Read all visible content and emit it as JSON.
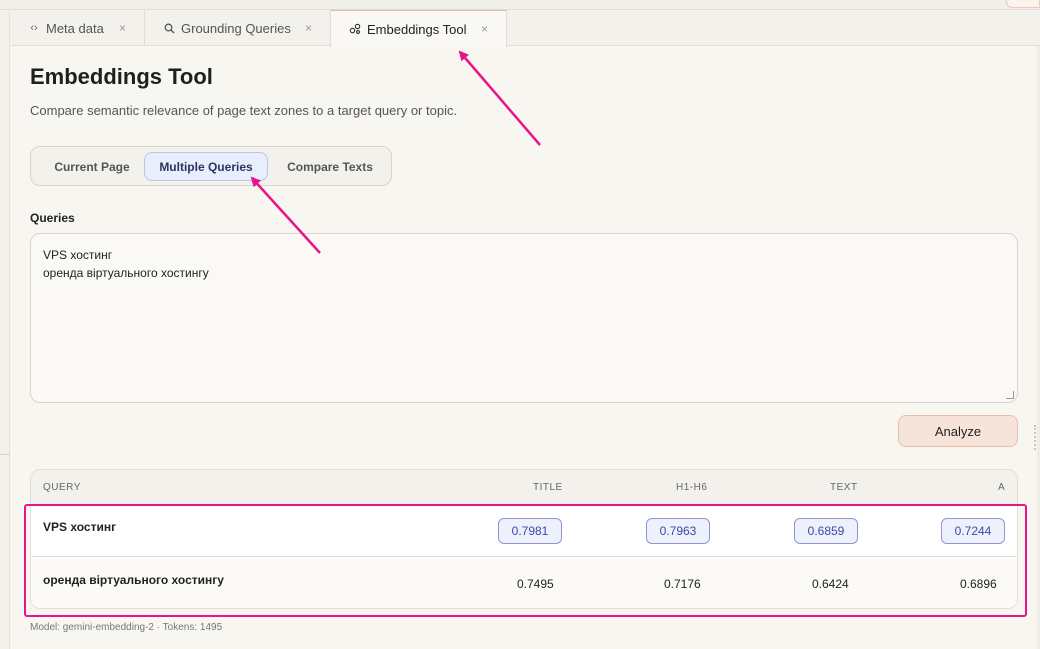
{
  "tabs": [
    {
      "icon": "code-icon",
      "label": "Meta data",
      "active": false
    },
    {
      "icon": "search-icon",
      "label": "Grounding Queries",
      "active": false
    },
    {
      "icon": "embeddings-icon",
      "label": "Embeddings Tool",
      "active": true
    }
  ],
  "tab_close_glyph": "×",
  "page": {
    "title": "Embeddings Tool",
    "subtitle": "Compare semantic relevance of page text zones to a target query or topic."
  },
  "modes": {
    "options": [
      "Current Page",
      "Multiple Queries",
      "Compare Texts"
    ],
    "selected": "Multiple Queries"
  },
  "queries": {
    "label": "Queries",
    "lines": [
      "VPS хостинг",
      "оренда віртуального хостингу"
    ]
  },
  "analyze_label": "Analyze",
  "results": {
    "headers": [
      "QUERY",
      "TITLE",
      "H1-H6",
      "TEXT",
      "A"
    ],
    "rows": [
      {
        "query": "VPS хостинг",
        "values": [
          "0.7981",
          "0.7963",
          "0.6859",
          "0.7244"
        ],
        "highlighted": true
      },
      {
        "query": "оренда віртуального хостингу",
        "values": [
          "0.7495",
          "0.7176",
          "0.6424",
          "0.6896"
        ],
        "highlighted": false
      }
    ]
  },
  "footer": "Model: gemini-embedding-2 · Tokens: 1495",
  "colors": {
    "annotation": "#e8148a",
    "accent_tab": "#e8b89c",
    "selected_mode_bg": "#e8eefb",
    "pill_border": "#8e98d6",
    "analyze_bg": "#f6e4db"
  }
}
